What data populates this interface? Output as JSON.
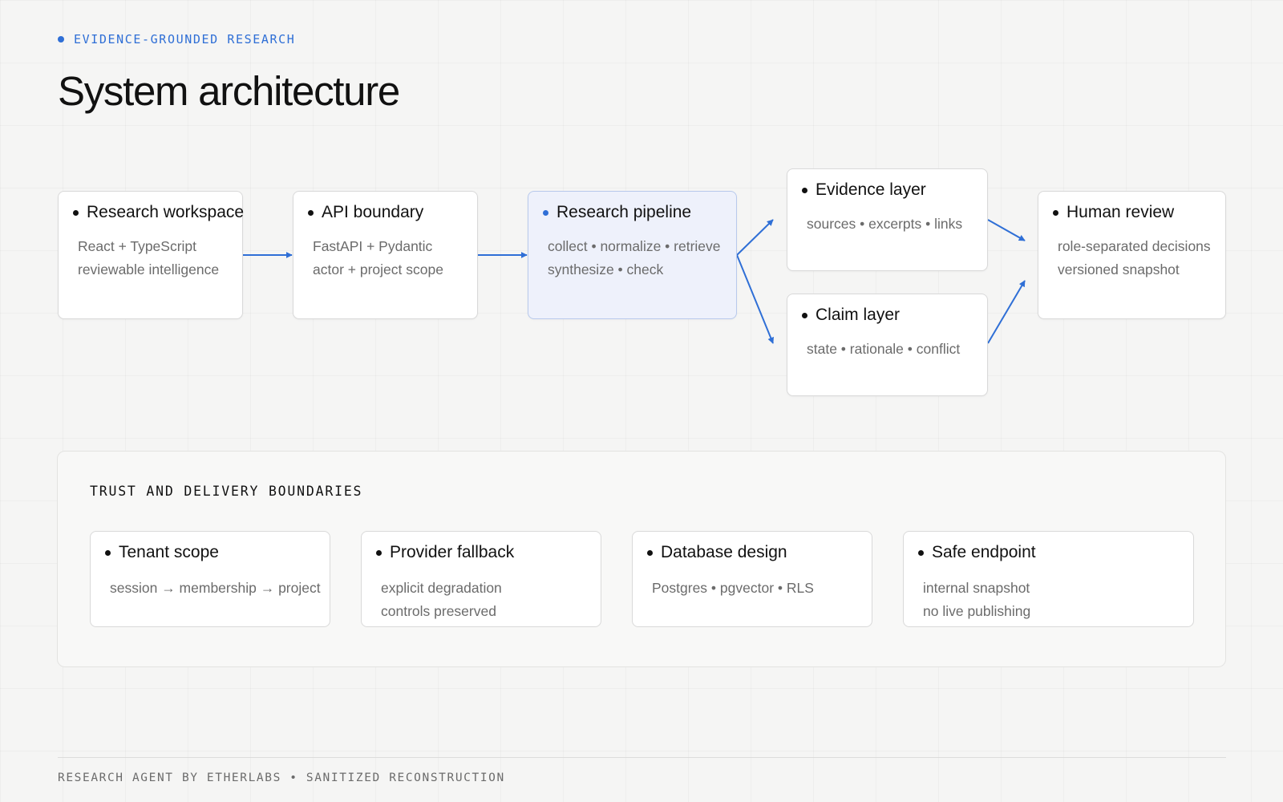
{
  "header": {
    "eyebrow": "EVIDENCE-GROUNDED RESEARCH",
    "title": "System architecture"
  },
  "colors": {
    "accent": "#2f6fd6",
    "highlight_bg": "#eef1fb",
    "highlight_border": "#b8c9ec"
  },
  "flow": {
    "workspace": {
      "title": "Research workspace",
      "lines": [
        "React + TypeScript",
        "reviewable intelligence"
      ]
    },
    "api": {
      "title": "API boundary",
      "lines": [
        "FastAPI + Pydantic",
        "actor + project scope"
      ]
    },
    "pipeline": {
      "title": "Research pipeline",
      "lines": [
        "collect • normalize • retrieve",
        "synthesize • check"
      ]
    },
    "evidence": {
      "title": "Evidence layer",
      "lines": [
        "sources • excerpts • links"
      ]
    },
    "claim": {
      "title": "Claim layer",
      "lines": [
        "state • rationale • conflict"
      ]
    },
    "review": {
      "title": "Human review",
      "lines": [
        "role-separated decisions",
        "versioned snapshot"
      ]
    }
  },
  "boundaries": {
    "title": "TRUST AND DELIVERY BOUNDARIES",
    "cards": [
      {
        "title": "Tenant scope",
        "lines": [
          "session → membership → project"
        ]
      },
      {
        "title": "Provider fallback",
        "lines": [
          "explicit degradation",
          "controls preserved"
        ]
      },
      {
        "title": "Database design",
        "lines": [
          "Postgres • pgvector • RLS"
        ]
      },
      {
        "title": "Safe endpoint",
        "lines": [
          "internal snapshot",
          "no live publishing"
        ]
      }
    ]
  },
  "footer": {
    "text": "RESEARCH AGENT BY ETHERLABS • SANITIZED RECONSTRUCTION"
  }
}
